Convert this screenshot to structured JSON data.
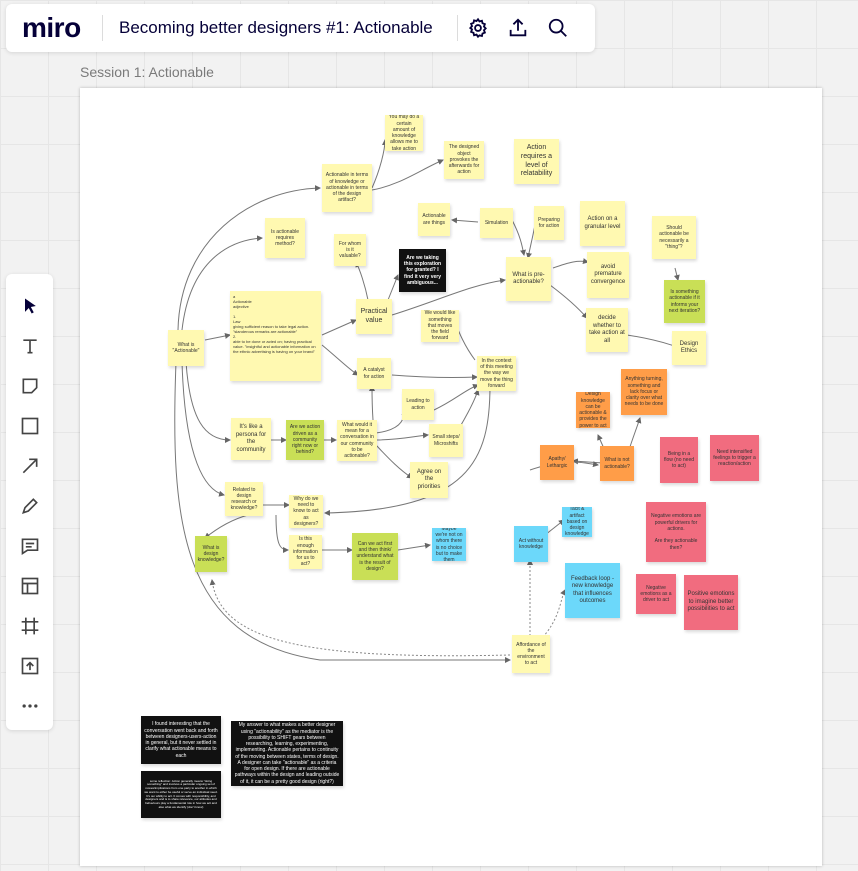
{
  "header": {
    "logo": "miro",
    "board_title": "Becoming better designers #1: Actionable",
    "icons": [
      "gear-icon",
      "upload-icon",
      "search-icon"
    ]
  },
  "toolbar": {
    "tools": [
      "select-cursor-icon",
      "text-icon",
      "sticky-note-icon",
      "shape-icon",
      "arrow-icon",
      "pen-icon",
      "comment-icon",
      "frame-layout-icon",
      "frame-icon",
      "upload-icon",
      "more-icon"
    ]
  },
  "frame": {
    "title": "Session 1: Actionable"
  },
  "colors": {
    "yellow": "#fff9b1",
    "green": "#c9df56",
    "blue": "#6cd8fa",
    "orange": "#ff9d48",
    "red": "#f16c7f",
    "black": "#111111"
  },
  "notes": {
    "what_is_actionable": "What is \"Actionable\"",
    "definition": "a\nActionable\nadjective\n\n1.\nLaw\ngiving sufficient reason to take legal action. \"slanderous remarks are actionable\"\n2.\nable to be done or acted on; having practical value. \"insightful and actionable information on the ethnic advertising is having on your brand\"",
    "knowledge_or_design": "Actionable in terms of knowledge or actionable in terms of the design artifact?",
    "know_enough": "You may do a certain amount of knowledge allows me to take action",
    "design_artifact": "The designed object provokes the afterwards for action",
    "relatability": "Action requires a level of relatability",
    "requires_method": "Is actionable requires method?",
    "for_whom": "For whom is it valuable?",
    "ambiguous": "Are we taking this exploration for granted? I find it very very ambiguous...",
    "practical_value": "Practical value",
    "actionable_are_things": "Actionable are things",
    "simulation": "Simulation",
    "preparing": "Preparing for action",
    "granular": "Action on a granular level",
    "should_be_thing": "Should actionable be necessarily a \"thing\"?",
    "informs": "Is something actionable if it informs your next iteration?",
    "pre_actionable": "What is pre-actionable?",
    "premature": "avoid premature convergence",
    "decide": "decide whether to take action at all",
    "ethics": "Design Ethics",
    "catalyst": "A catalyst for action",
    "moves_forward": "We would like something that moves the field forward",
    "context": "In the context of this meeting the way we move the thing forward",
    "persona": "It's like a persona for the community",
    "community": "Are we action driven as a community right now or behind?",
    "conversation": "What would it mean for a conversation in our community to be actionable?",
    "leading": "Leading to action",
    "small_steps": "Small steps/ Microshifts",
    "priorities": "Agree on the priorities",
    "related_research": "Related to design research or knowledge?",
    "what_is_knowledge": "What is design knowledge?",
    "enough_knowledge": "Why do we need to know to act as designers?",
    "know_enough_act": "Is this enough information for us to act?",
    "act_first": "Can we act first and then think/ understand what is the result of design?",
    "maybe_not": "Maybe we're not on whom there is no choice but to make them",
    "act_without": "Act without knowledge",
    "feedback_loop": "Feedback loop - new knowledge that influences outcomes",
    "tacit": "Tacit & artifact based on design knowledge",
    "affordance": "Affordance of the environment to act",
    "design_knowledge": "Design knowledge can be actionable & provides the power to act",
    "anything_turning": "Anything turning, something and lack focus or clarity over what needs to be done",
    "apathy": "Apathy/ Lethargic",
    "what_is_not": "What is not actionable?",
    "being_in_flow": "Being in a flow (no need to act)",
    "intensified": "Need intensified feelings to trigger a reaction/action",
    "negative_drivers": "Negative emotions are powerful drivers for actions.\n\nAre they actionable then?",
    "negative_driver": "Negative emotions as a driver to act",
    "positive": "Positive emotions to imagine better possibilities to act",
    "black_comment_1": "I found interesting that the conversation went back and forth between designers-users-action in general, but it never settled in clarify what actionable means to each",
    "black_comment_2": "some reflection: Action generally means \"doing something\" and involves a particular ongoing set of moves/implications from one party to another in which we want to either be useful or serve an individual need. It's our ability to act. It comes with responsibility, and designers and is to share relevance, our attitudes and behaviours play a fundamental role in how we act and also what we identify (don't know)",
    "black_comment_3": "My answer to what makes a better designer using \"actionability\" as the mediator is the possibility to SHIFT gears between researching, learning, experimenting, implementing. Actionable pertains to continuity of the moving between states, terms of design. A designer can take \"actionable\" as a criteria for open design. If there are actionable pathways within the design and leading outside of it, it can be a pretty good design (right?)"
  }
}
